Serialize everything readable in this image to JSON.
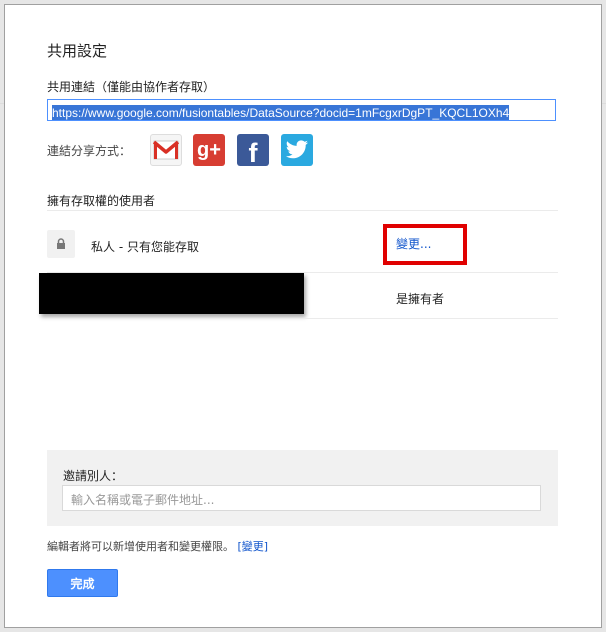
{
  "dialog": {
    "title": "共用設定",
    "link_label": "共用連結（僅能由協作者存取）",
    "share_url": "https://www.google.com/fusiontables/DataSource?docid=1mFcgxrDgPT_KQCL1OXh4",
    "share_via_label": "連結分享方式：",
    "share_icons": [
      "gmail-icon",
      "google-plus-icon",
      "facebook-icon",
      "twitter-icon"
    ],
    "access_label": "擁有存取權的使用者",
    "visibility": {
      "text": "私人 - 只有您能存取",
      "change_link": "變更..."
    },
    "owner": {
      "role": "是擁有者"
    },
    "invite": {
      "label": "邀請別人：",
      "placeholder": "輸入名稱或電子郵件地址..."
    },
    "footer": {
      "text": "編輯者將可以新增使用者和變更權限。",
      "link": "[變更]"
    },
    "done_label": "完成"
  },
  "colors": {
    "accent_blue": "#4d90fe",
    "link_blue": "#1155cc",
    "highlight_red": "#e00000",
    "gplus_red": "#d73d32",
    "facebook_blue": "#3b5998",
    "twitter_blue": "#2aa9e0"
  }
}
